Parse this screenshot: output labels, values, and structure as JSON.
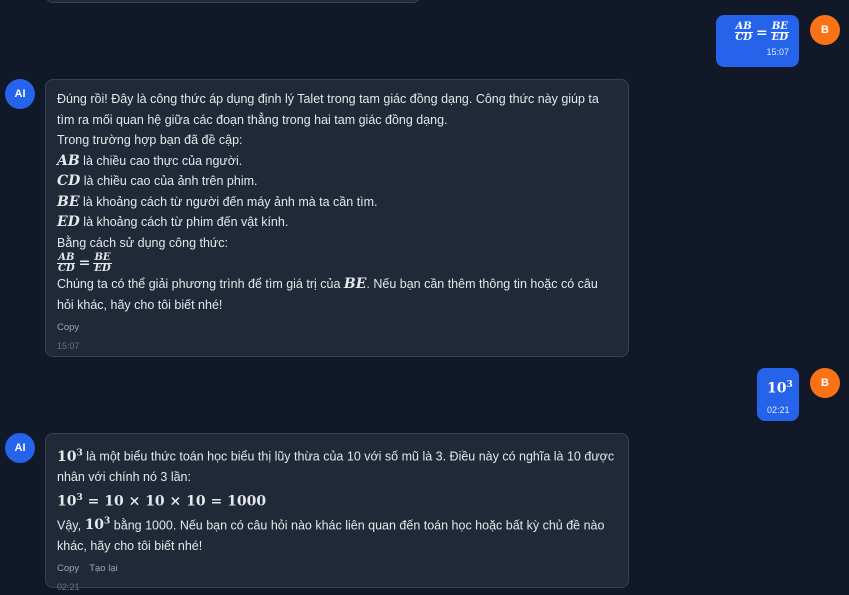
{
  "messages": {
    "m1_user": {
      "avatar": "B",
      "lhs_num": "AB",
      "lhs_den": "CD",
      "eq": "=",
      "rhs_num": "BE",
      "rhs_den": "ED",
      "time": "15:07"
    },
    "m2_ai": {
      "avatar": "AI",
      "l1": "Đúng rồi! Đây là công thức áp dụng định lý Talet trong tam giác đồng dạng. Công thức này giúp ta",
      "l2": "tìm ra mối quan hệ giữa các đoạn thẳng trong hai tam giác đồng dạng.",
      "l3": "Trong trường hợp bạn đã đề cập:",
      "v1": "AB",
      "t1": " là chiều cao thực của người.",
      "v2": "CD",
      "t2": " là chiều cao của ảnh trên phim.",
      "v3": "BE",
      "t3": " là khoảng cách từ người đến máy ảnh mà ta cần tìm.",
      "v4": "ED",
      "t4": " là khoảng cách từ phim đến vật kính.",
      "l8": "Bằng cách sử dụng công thức:",
      "f_lhs_num": "AB",
      "f_lhs_den": "CD",
      "f_eq": "=",
      "f_rhs_num": "BE",
      "f_rhs_den": "ED",
      "l10a": "Chúng ta có thể giải phương trình để tìm giá trị của ",
      "l10v": "BE",
      "l10b": ". Nếu bạn cần thêm thông tin hoặc có câu",
      "l11": "hỏi khác, hãy cho tôi biết nhé!",
      "copy": "Copy",
      "time": "15:07"
    },
    "m3_user": {
      "avatar": "B",
      "base": "10",
      "exp": "3",
      "time": "02:21"
    },
    "m4_ai": {
      "avatar": "AI",
      "base": "10",
      "exp": "3",
      "l1": " là một biểu thức toán học biểu thị lũy thừa của 10 với số mũ là 3. Điều này có nghĩa là 10 được",
      "l2": "nhân với chính nó 3 lần:",
      "eq_base": "10",
      "eq_exp": "3",
      "eq_rest": " = 10 × 10 × 10 = 1000",
      "l4a": "Vậy, ",
      "l4_base": "10",
      "l4_exp": "3",
      "l4b": " bằng 1000. Nếu bạn có câu hỏi nào khác liên quan đến toán học hoặc bất kỳ chủ đề nào",
      "l5": "khác, hãy cho tôi biết nhé!",
      "copy": "Copy",
      "regenerate": "Tạo lại",
      "time": "02:21"
    }
  }
}
